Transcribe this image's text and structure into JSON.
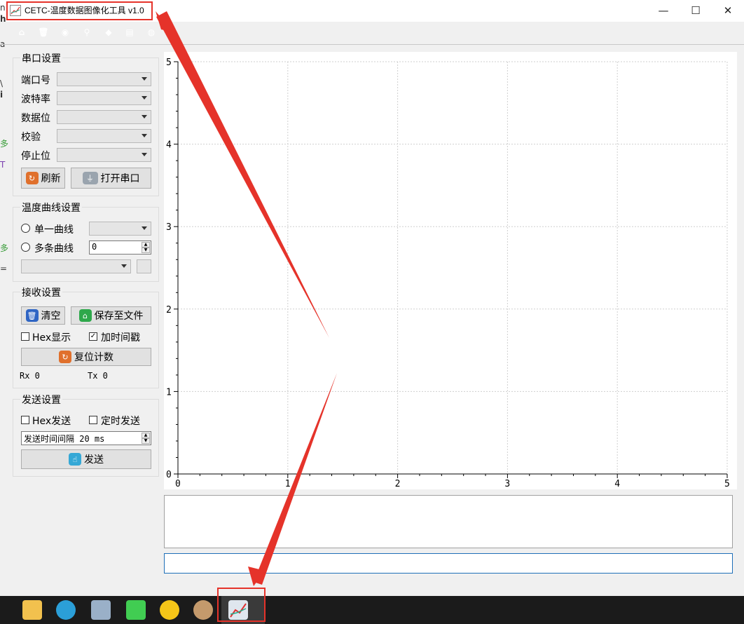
{
  "window": {
    "title": "CETC-温度数据图像化工具 v1.0",
    "min_glyph": "—",
    "max_glyph": "☐",
    "close_glyph": "✕"
  },
  "left_cut_text": [
    "n",
    "h",
    "a",
    "\\",
    "i",
    "多",
    "T",
    "多",
    "="
  ],
  "toolbar": {
    "icons": [
      {
        "name": "save-icon",
        "color": "#2ea84b",
        "glyph": "⌂"
      },
      {
        "name": "trash-icon",
        "color": "#2f65c4",
        "glyph": "🗑"
      },
      {
        "name": "eye-icon",
        "color": "#d9482b",
        "glyph": "◉"
      },
      {
        "name": "search-icon",
        "color": "#2f65c4",
        "glyph": "⚲"
      },
      {
        "name": "location-icon",
        "color": "#7cbc2b",
        "glyph": "◆"
      },
      {
        "name": "document-icon",
        "color": "#d8336a",
        "glyph": "▤"
      },
      {
        "name": "globe-icon",
        "color": "#2a86d5",
        "glyph": "◍"
      }
    ]
  },
  "serial": {
    "title": "串口设置",
    "port_label": "端口号",
    "baud_label": "波特率",
    "databits_label": "数据位",
    "parity_label": "校验",
    "stopbits_label": "停止位",
    "refresh_label": "刷新",
    "open_label": "打开串口"
  },
  "curve": {
    "title": "温度曲线设置",
    "single_label": "单一曲线",
    "multi_label": "多条曲线",
    "multi_count": "0"
  },
  "receive": {
    "title": "接收设置",
    "clear_label": "清空",
    "save_label": "保存至文件",
    "hex_display_label": "Hex显示",
    "hex_display_checked": false,
    "timestamp_label": "加时间戳",
    "timestamp_checked": true,
    "reset_label": "复位计数",
    "rx_text": "Rx 0",
    "tx_text": "Tx 0"
  },
  "send": {
    "title": "发送设置",
    "hex_send_label": "Hex发送",
    "hex_send_checked": false,
    "timed_send_label": "定时发送",
    "timed_send_checked": false,
    "interval_text": "发送时间间隔 20 ms",
    "send_label": "发送"
  },
  "chart_data": {
    "type": "line",
    "series": [],
    "xlim": [
      0,
      5
    ],
    "ylim": [
      0,
      5
    ],
    "xticks": [
      "0",
      "1",
      "2",
      "3",
      "4",
      "5"
    ],
    "yticks": [
      "0",
      "1",
      "2",
      "3",
      "4",
      "5"
    ],
    "grid": true
  },
  "taskbar": {
    "apps": [
      {
        "name": "file-explorer-icon",
        "color": "#f2c14e"
      },
      {
        "name": "edge-browser-icon",
        "color": "#2b9fd8"
      },
      {
        "name": "network-app-icon",
        "color": "#9ab0c8"
      },
      {
        "name": "qt-creator-icon",
        "color": "#41cd52"
      },
      {
        "name": "music-app-icon",
        "color": "#f5c518"
      },
      {
        "name": "paint-app-icon",
        "color": "#c49a6c"
      },
      {
        "name": "temperature-tool-icon",
        "color": "#dfe6ee"
      }
    ]
  },
  "annotation_color": "#e5332a"
}
